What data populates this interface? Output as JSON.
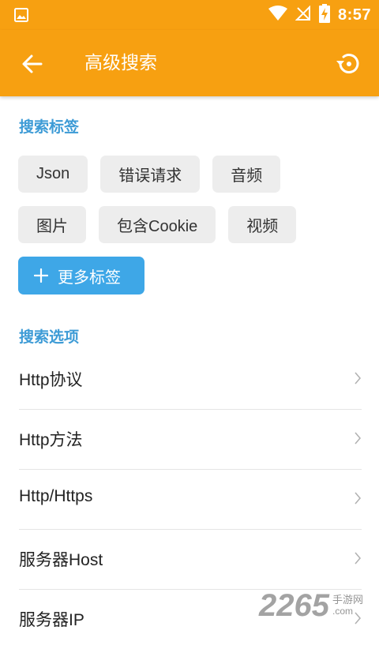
{
  "status_bar": {
    "time": "8:57",
    "icons": [
      "image-notification-icon",
      "wifi-icon",
      "no-signal-icon",
      "battery-charging-icon"
    ]
  },
  "app_bar": {
    "title": "高级搜索",
    "back_icon": "arrow-left-icon",
    "reset_icon": "reset-icon"
  },
  "tags_section": {
    "label": "搜索标签",
    "rows": [
      [
        "Json",
        "错误请求",
        "音频"
      ],
      [
        "图片",
        "包含Cookie",
        "视频"
      ]
    ],
    "more_button": "更多标签"
  },
  "options_section": {
    "label": "搜索选项",
    "items": [
      "Http协议",
      "Http方法",
      "Http/Https",
      "服务器Host",
      "服务器IP"
    ]
  },
  "watermark": {
    "number": "2265",
    "text": "手游网",
    "domain": ".com"
  },
  "colors": {
    "primary": "#f7a011",
    "accent_blue": "#3ea7e7",
    "section_label": "#3d9bd6",
    "chip_bg": "#ededed"
  }
}
